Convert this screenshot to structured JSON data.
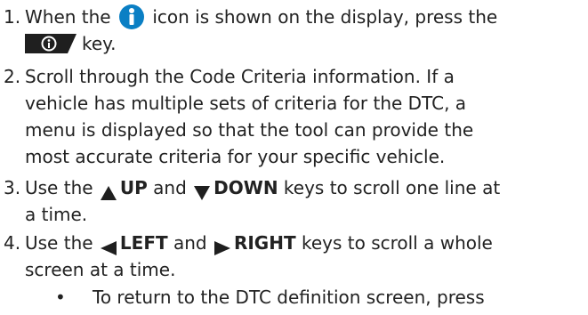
{
  "steps": [
    {
      "number": "1.",
      "text_before_icon": "When the ",
      "icon": "info-circle-icon",
      "text_after_icon": " icon is shown on the display, press the",
      "key_icon": "info-key-icon",
      "text_after_key": "key."
    },
    {
      "number": "2.",
      "lines": [
        "Scroll through the Code Criteria information. If a",
        "vehicle has multiple sets of criteria for the DTC, a",
        "menu is displayed so that the tool can provide the",
        "most accurate criteria for your specific vehicle."
      ]
    },
    {
      "number": "3.",
      "text_use": "Use the ",
      "up_icon": "up-triangle-icon",
      "up_label": "UP",
      "text_and": " and ",
      "down_icon": "down-triangle-icon",
      "down_label": "DOWN",
      "text_rest": " keys to scroll one line at",
      "line2": "a time."
    },
    {
      "number": "4.",
      "text_use": "Use the ",
      "left_icon": "left-triangle-icon",
      "left_label": "LEFT",
      "text_and": " and ",
      "right_icon": "right-triangle-icon",
      "right_label": "RIGHT",
      "text_rest": " keys to scroll a whole",
      "line2": "screen at a time."
    }
  ],
  "bullet": {
    "symbol": "•",
    "text": "To return to the DTC definition screen, press"
  },
  "colors": {
    "text": "#222222",
    "info_blue": "#0a7fc4",
    "key_dark": "#1f1f1f",
    "triangle": "#1f1f1f"
  }
}
